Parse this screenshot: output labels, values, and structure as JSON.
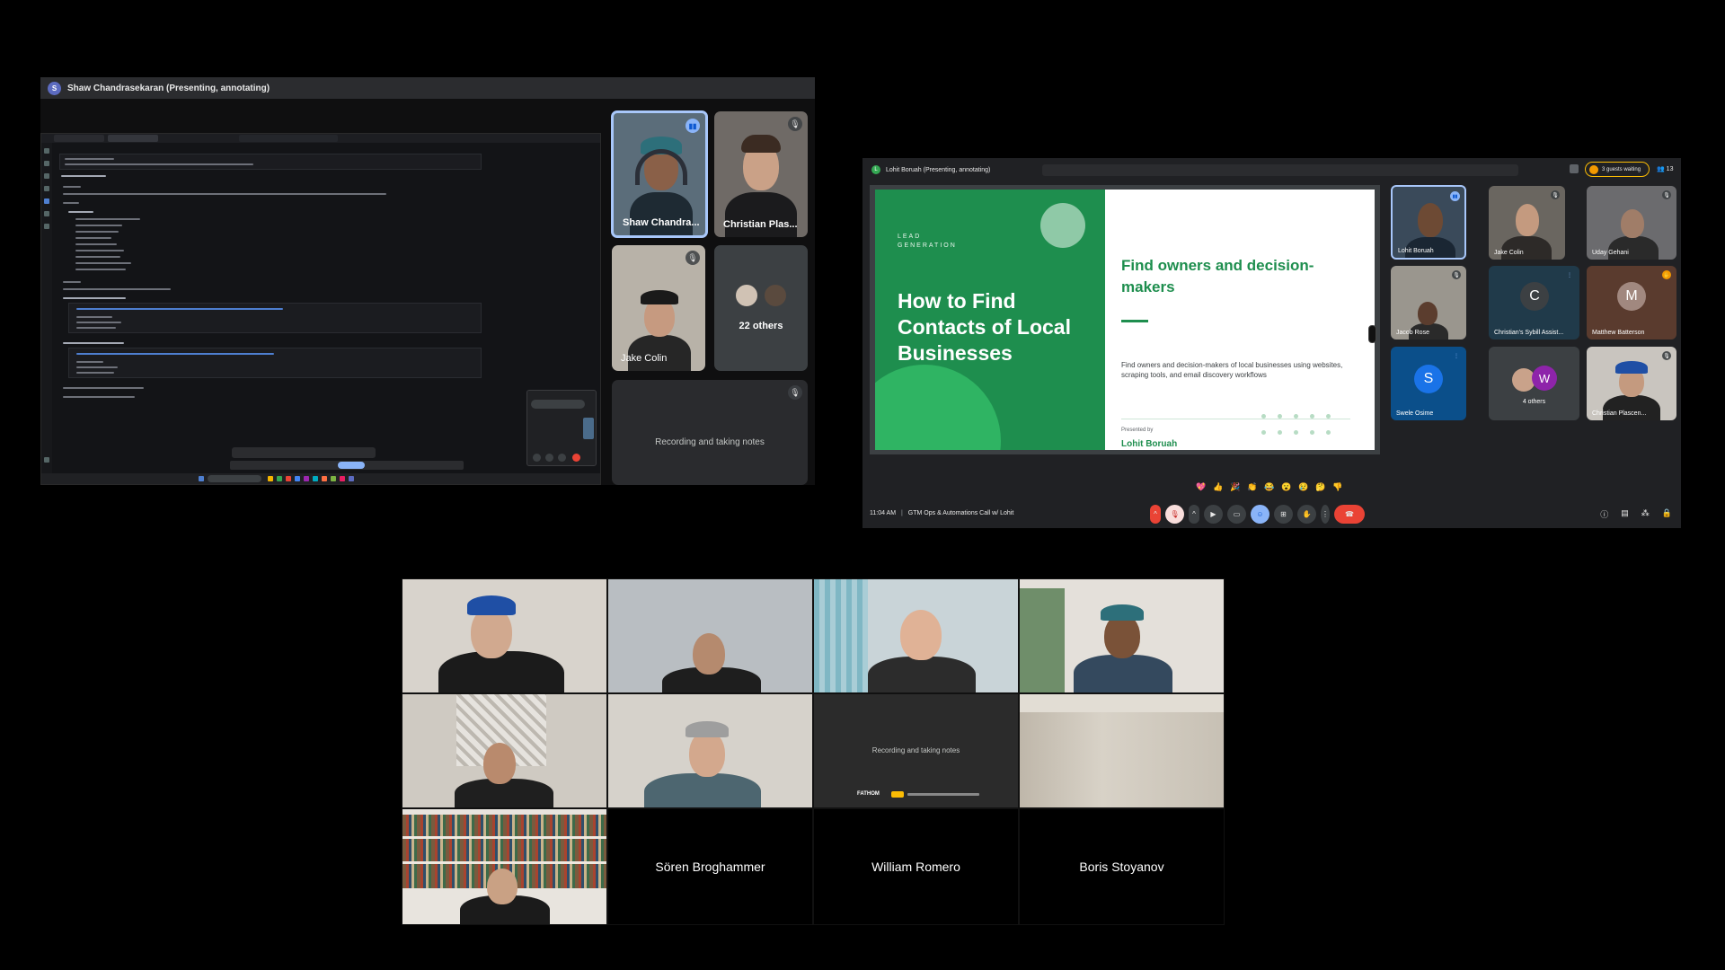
{
  "panel1": {
    "presenter_avatar_letter": "S",
    "presenter_label": "Shaw Chandrasekaran (Presenting, annotating)",
    "tiles": [
      {
        "name": "Shaw Chandra..."
      },
      {
        "name": "Christian Plas..."
      },
      {
        "name": "Jake Colin"
      }
    ],
    "others_label": "22 others",
    "notes_label": "Recording and taking notes"
  },
  "panel2": {
    "presenter_avatar_letter": "L",
    "presenter_label": "Lohit Boruah (Presenting, annotating)",
    "guests_waiting": "3 guests waiting",
    "participant_count": "13",
    "slide": {
      "kicker_line1": "LEAD",
      "kicker_line2": "GENERATION",
      "title": "How to Find Contacts of Local Businesses",
      "heading": "Find owners and decision-makers",
      "body": "Find owners and decision-makers of local businesses using websites, scraping tools, and email discovery workflows",
      "presented_by": "Presented by",
      "presenter": "Lohit Boruah"
    },
    "tiles": [
      {
        "name": "Lohit Boruah"
      },
      {
        "name": "Jake Colin"
      },
      {
        "name": "Uday Gehani"
      },
      {
        "name": "Jacob Rose"
      },
      {
        "name": "Christian's Sybill Assist...",
        "letter": "C"
      },
      {
        "name": "Matthew Batterson",
        "letter": "M"
      },
      {
        "name": "Swele Osime",
        "letter": "S"
      },
      {
        "name": "4 others",
        "letter": "W"
      },
      {
        "name": "Christian Plascen..."
      }
    ],
    "emojis": [
      "💖",
      "👍",
      "🎉",
      "👏",
      "😂",
      "😮",
      "😢",
      "🤔",
      "👎"
    ],
    "time": "11:04 AM",
    "meeting_title": "GTM Ops & Automations Call w/ Lohit",
    "colors": {
      "accent_green": "#1e8e4e",
      "hangup_red": "#ea4335",
      "guests_yellow": "#fbbc04"
    }
  },
  "panel3": {
    "notes_label": "Recording and taking notes",
    "fathom_label": "FATHOM",
    "names": [
      "Sören Broghammer",
      "William Romero",
      "Boris Stoyanov"
    ]
  }
}
